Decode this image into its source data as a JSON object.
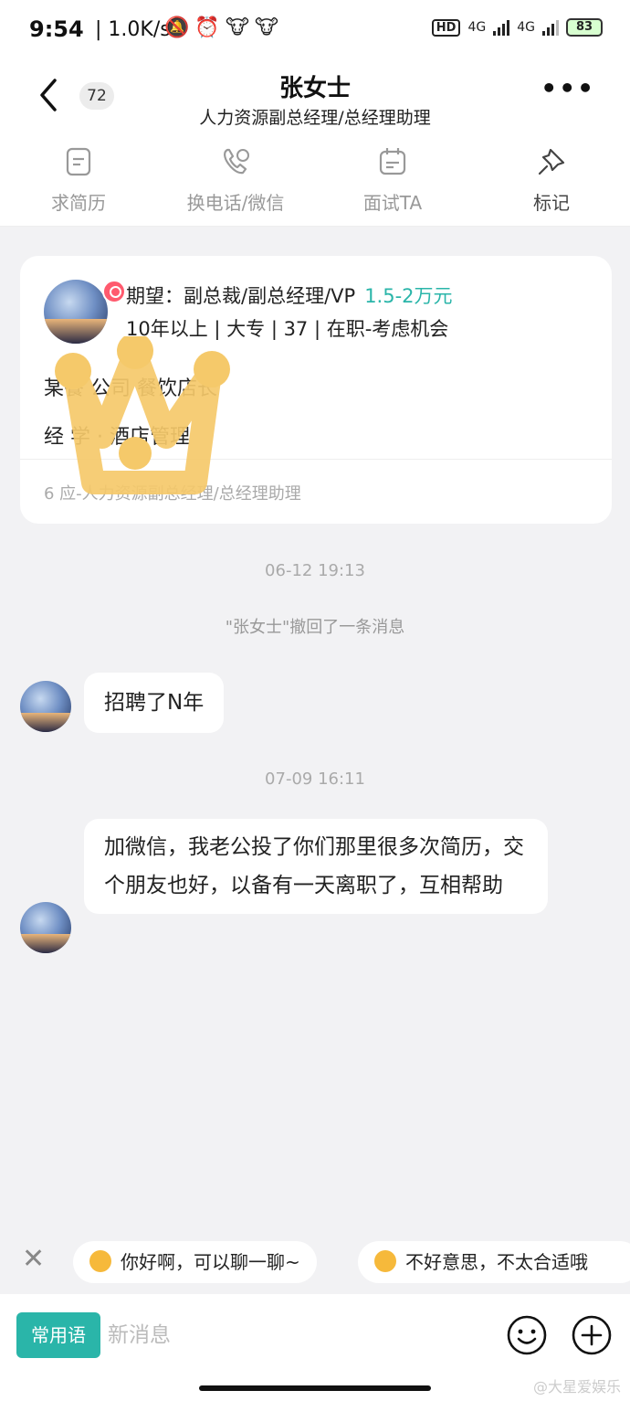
{
  "status_bar": {
    "time": "9:54",
    "speed": "| 1.0K/s",
    "net1": "4G",
    "net2": "4G",
    "hd": "HD",
    "battery": "83"
  },
  "header": {
    "unread_count": "72",
    "name": "张女士",
    "position": "人力资源副总经理/总经理助理"
  },
  "actions": [
    {
      "label": "求简历",
      "icon": "resume-icon"
    },
    {
      "label": "换电话/微信",
      "icon": "phone-icon"
    },
    {
      "label": "面试TA",
      "icon": "calendar-icon"
    },
    {
      "label": "标记",
      "icon": "pin-icon"
    }
  ],
  "profile": {
    "expect_label": "期望：副总裁/副总经理/VP",
    "salary": "1.5-2万元",
    "meta": "10年以上 | 大专 | 37 | 在职-考虑机会",
    "job": "某餐  公司  餐饮店长",
    "skills": "    经  学   · 酒店管理",
    "footer": "6     应-人力资源副总经理/总经理助理"
  },
  "timestamps": {
    "t1": "06-12 19:13",
    "t2": "07-09 16:11"
  },
  "system_message": "\"张女士\"撤回了一条消息",
  "messages": [
    {
      "text": "招聘了N年"
    },
    {
      "text": "加微信，我老公投了你们那里很多次简历，交个朋友也好，以备有一天离职了，互相帮助"
    }
  ],
  "quick_replies": [
    {
      "text": "你好啊，可以聊一聊~"
    },
    {
      "text": "不好意思，不太合适哦"
    }
  ],
  "input": {
    "phrase_button": "常用语",
    "placeholder": "新消息"
  },
  "watermark": "@大星爱娱乐",
  "colors": {
    "accent": "#2ab5a9",
    "crown": "#f5c96a",
    "background": "#f2f2f4"
  }
}
